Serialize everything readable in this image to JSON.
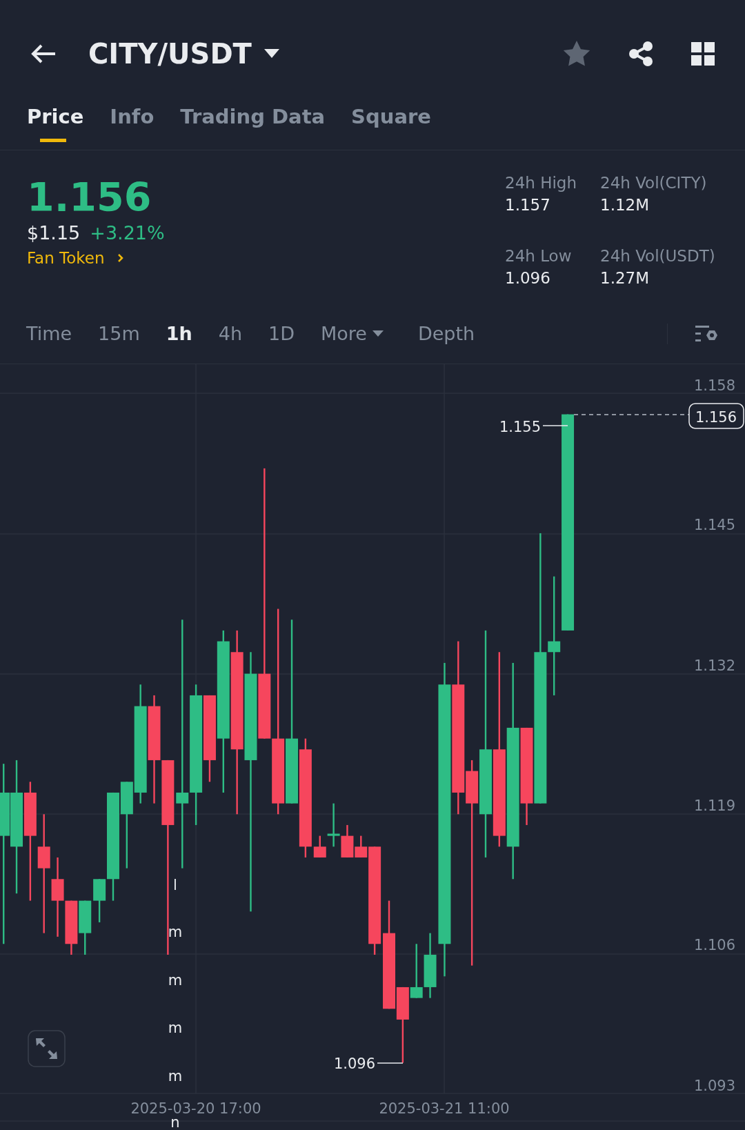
{
  "header": {
    "title": "CITY/USDT"
  },
  "tabs": [
    {
      "label": "Price",
      "selected": true
    },
    {
      "label": "Info",
      "selected": false
    },
    {
      "label": "Trading Data",
      "selected": false
    },
    {
      "label": "Square",
      "selected": false
    }
  ],
  "price": {
    "last": "1.156",
    "usd": "$1.15",
    "change": "+3.21%",
    "tag": "Fan Token"
  },
  "stats": [
    {
      "label": "24h High",
      "value": "1.157"
    },
    {
      "label": "24h Vol(CITY)",
      "value": "1.12M"
    },
    {
      "label": "24h Low",
      "value": "1.096"
    },
    {
      "label": "24h Vol(USDT)",
      "value": "1.27M"
    }
  ],
  "intervals": [
    {
      "label": "Time",
      "kind": "interval",
      "selected": false
    },
    {
      "label": "15m",
      "kind": "interval",
      "selected": false
    },
    {
      "label": "1h",
      "kind": "interval",
      "selected": true
    },
    {
      "label": "4h",
      "kind": "interval",
      "selected": false
    },
    {
      "label": "1D",
      "kind": "interval",
      "selected": false
    },
    {
      "label": "More",
      "kind": "menu",
      "selected": false
    },
    {
      "label": "Depth",
      "kind": "interval",
      "selected": false
    }
  ],
  "chart": {
    "y_axis_labels": [
      "1.158",
      "1.145",
      "1.132",
      "1.119",
      "1.106",
      "1.093"
    ],
    "high_label": "1.155",
    "low_label": "1.096",
    "current_price": "1.156",
    "x_axis_labels": [
      "2025-03-20 17:00",
      "2025-03-21 11:00"
    ],
    "overlay_letters": [
      "l",
      "m",
      "m",
      "m",
      "m",
      "n"
    ]
  }
}
